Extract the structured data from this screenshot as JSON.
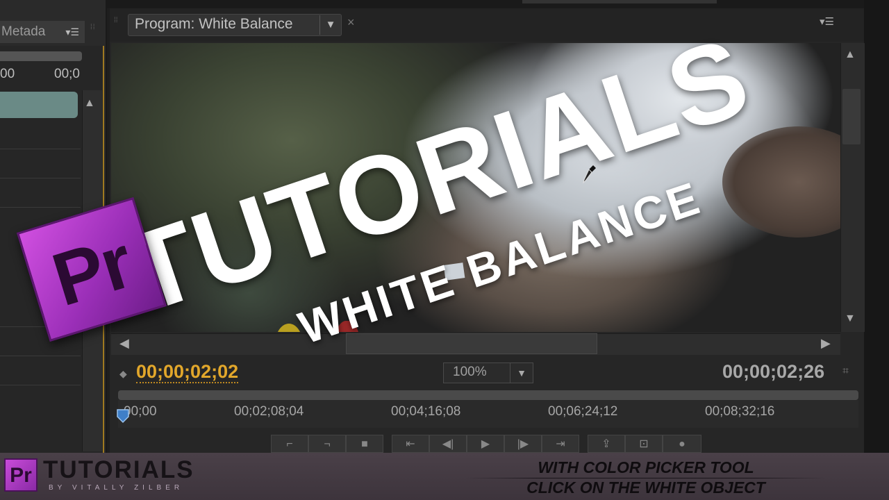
{
  "left_panel": {
    "tab_label": "Metada",
    "timecode_start": "00",
    "timecode_end": "00;0"
  },
  "monitor": {
    "tab_label": "Program: White Balance",
    "current_timecode": "00;00;02;02",
    "zoom": "100%",
    "duration": "00;00;02;26",
    "ruler_labels": [
      "00;00",
      "00;02;08;04",
      "00;04;16;08",
      "00;06;24;12",
      "00;08;32;16"
    ]
  },
  "overlay": {
    "title": "TUTORIALS",
    "subtitle": "WHITE BALANCE",
    "logo_text": "Pr"
  },
  "bottom_bar": {
    "logo_text": "Pr",
    "title": "TUTORIALS",
    "byline": "BY VITALLY ZILBER",
    "line1": "WITH COLOR PICKER TOOL",
    "line2": "CLICK ON THE WHITE OBJECT"
  },
  "colors": {
    "timecode_accent": "#e2a72b",
    "logo_purple": "#9b2fb8"
  },
  "icons": [
    "panel-menu-icon",
    "dropdown-arrow-icon",
    "close-icon",
    "scroll-up-icon",
    "scroll-down-icon",
    "scroll-left-icon",
    "scroll-right-icon",
    "eyedropper-icon",
    "playhead-icon",
    "marker-icon"
  ]
}
